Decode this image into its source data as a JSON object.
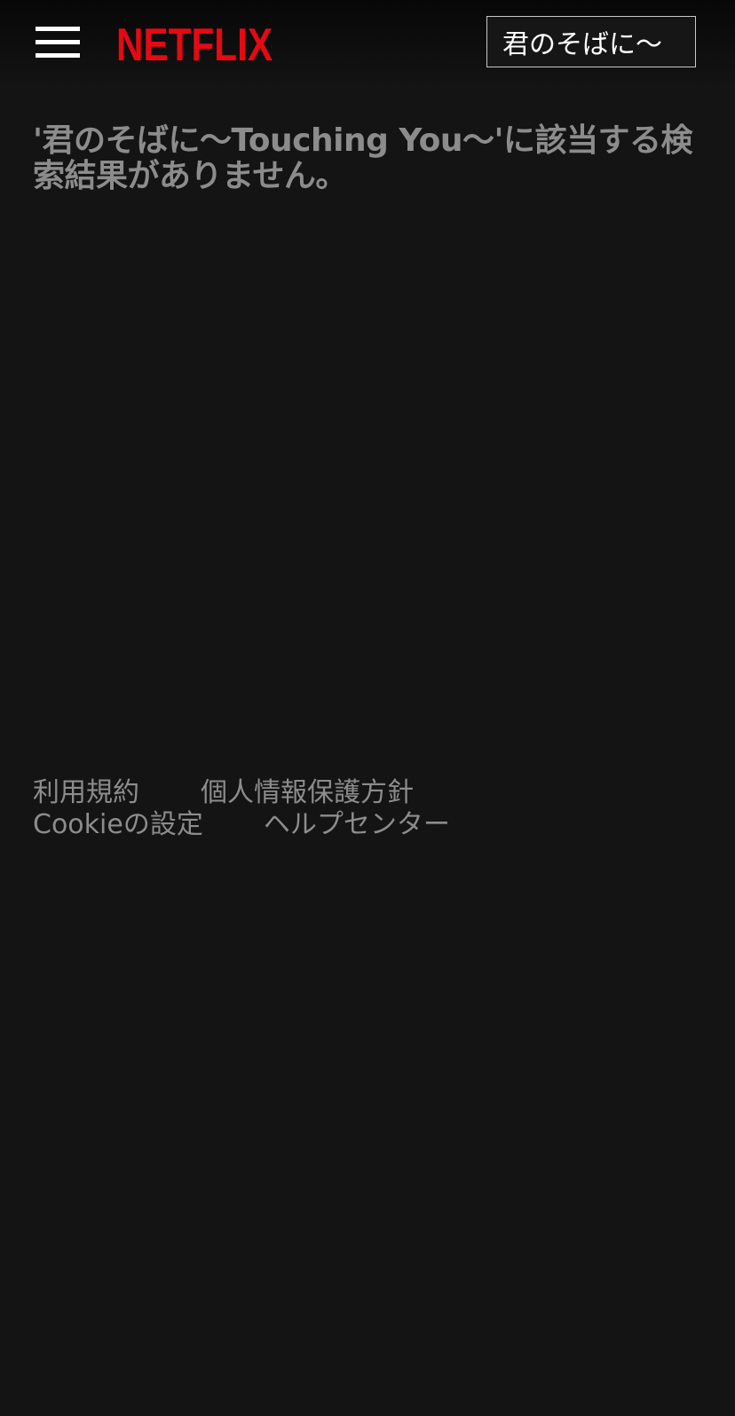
{
  "header": {
    "menu_icon": "hamburger-menu-icon",
    "logo_text": "NETFLIX",
    "brand_color": "#e50914",
    "search": {
      "value": "君のそばに〜Touching You〜",
      "visible_value": "君のそばに〜"
    }
  },
  "main": {
    "no_results_message": "'君のそばに〜Touching You〜'に該当する検索結果がありません。"
  },
  "footer": {
    "links": [
      {
        "label": "利用規約"
      },
      {
        "label": "個人情報保護方針"
      },
      {
        "label": "Cookieの設定"
      },
      {
        "label": "ヘルプセンター"
      }
    ]
  }
}
